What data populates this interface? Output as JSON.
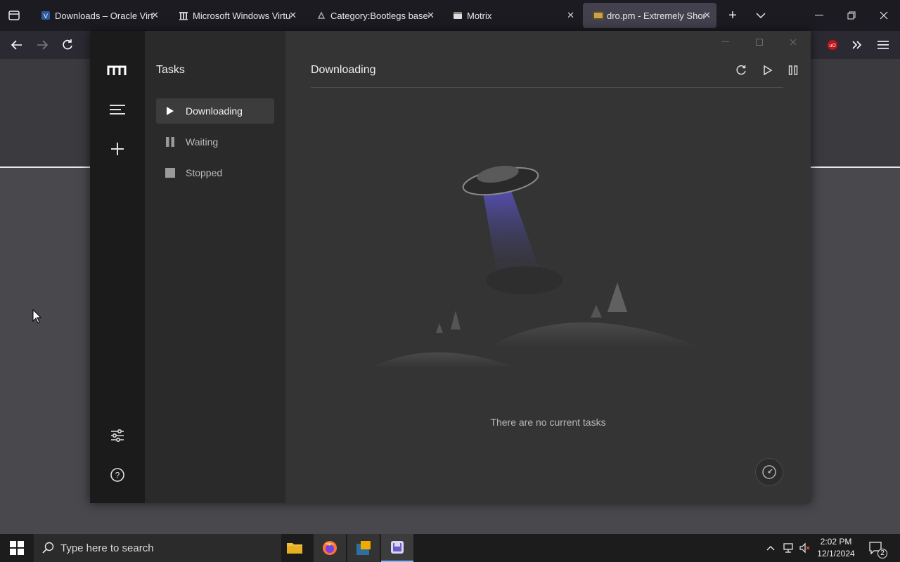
{
  "browser": {
    "tabs": [
      {
        "title": "Downloads – Oracle VirtualBox",
        "icon": "virtualbox-icon",
        "active": false
      },
      {
        "title": "Microsoft Windows Virtual PC",
        "icon": "wikipedia-icon",
        "active": false
      },
      {
        "title": "Category:Bootlegs based on",
        "icon": "wiki-icon",
        "active": false
      },
      {
        "title": "Motrix",
        "icon": "motrix-window-icon",
        "active": false
      },
      {
        "title": "dro.pm - Extremely Short URL",
        "icon": "dro-icon",
        "active": true
      }
    ],
    "close_glyph": "✕",
    "new_tab_glyph": "+",
    "list_all_tabs_glyph": "⌄"
  },
  "motrix": {
    "sidebar_title": "Tasks",
    "task_lists": [
      {
        "label": "Downloading",
        "icon": "play-icon",
        "active": true
      },
      {
        "label": "Waiting",
        "icon": "pause-icon",
        "active": false
      },
      {
        "label": "Stopped",
        "icon": "stop-icon",
        "active": false
      }
    ],
    "main_title": "Downloading",
    "empty_message": "There are no current tasks"
  },
  "taskbar": {
    "search_placeholder": "Type here to search",
    "time": "2:02 PM",
    "date": "12/1/2024",
    "notification_count": "2"
  },
  "colors": {
    "ufo_beam": "#5b54c8",
    "ublock_badge": "#c0131b",
    "firefox_tabbar": "#1c1b22"
  }
}
